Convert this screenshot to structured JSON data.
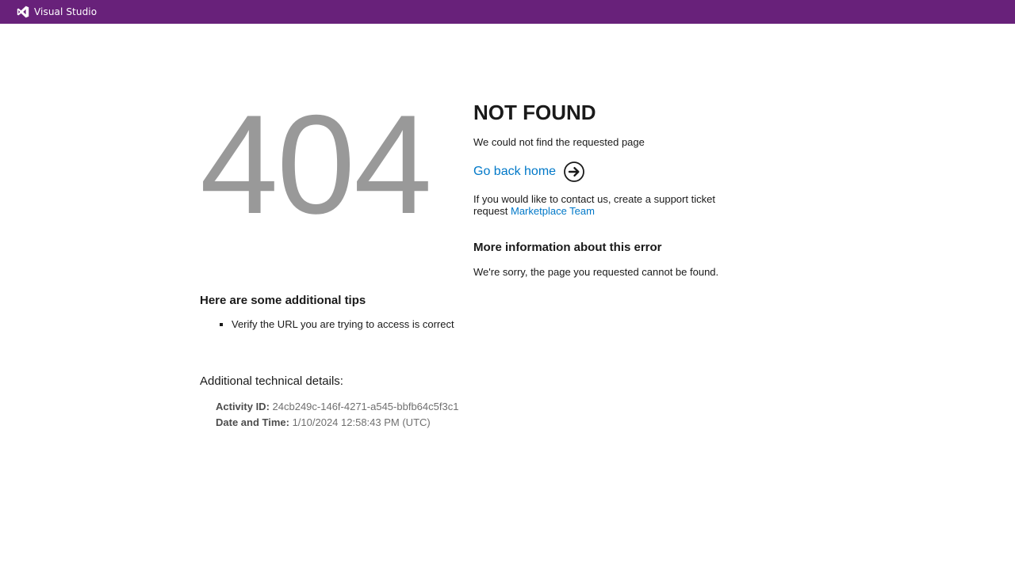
{
  "header": {
    "brand_name": "Visual Studio",
    "brand_icon": "visual-studio-logo",
    "background_color": "#68217a"
  },
  "error": {
    "code": "404",
    "title": "NOT FOUND",
    "subtitle": "We could not find the requested page",
    "home_link_label": "Go back home",
    "home_link_icon": "arrow-right-circle-icon",
    "contact_text": "If you would like to contact us, create a support ticket request",
    "contact_link_label": "Marketplace Team",
    "more_info_title": "More information about this error",
    "more_info_text": "We're sorry, the page you requested cannot be found."
  },
  "tips": {
    "title": "Here are some additional tips",
    "items": [
      "Verify the URL you are trying to access is correct"
    ]
  },
  "technical": {
    "title": "Additional technical details:",
    "activity_id_label": "Activity ID:",
    "activity_id_value": "24cb249c-146f-4271-a545-bbfb64c5f3c1",
    "datetime_label": "Date and Time:",
    "datetime_value": "1/10/2024 12:58:43 PM (UTC)"
  },
  "colors": {
    "accent_link": "#0078c8",
    "code_gray": "#999999"
  }
}
